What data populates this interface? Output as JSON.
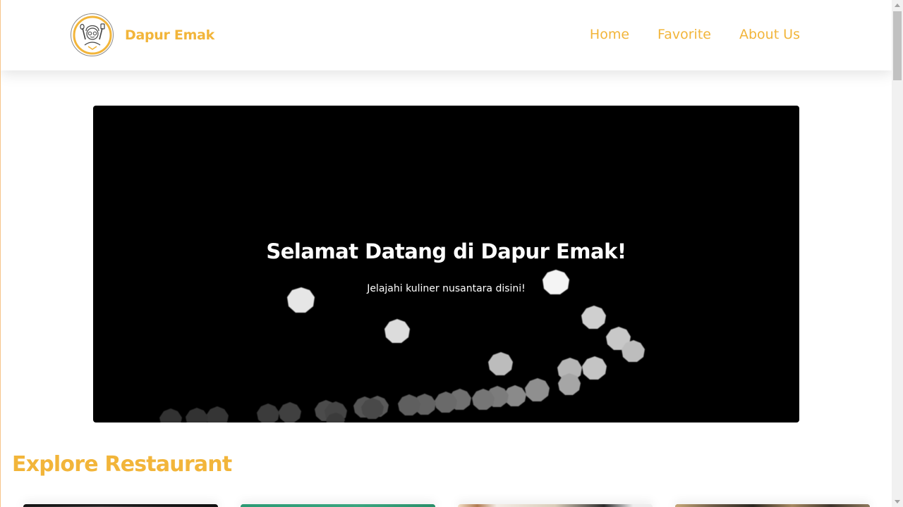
{
  "header": {
    "brand_name": "Dapur Emak",
    "logo_icon": "grandma-chef-logo",
    "nav": [
      {
        "label": "Home"
      },
      {
        "label": "Favorite"
      },
      {
        "label": "About Us"
      }
    ]
  },
  "hero": {
    "title": "Selamat Datang di Dapur Emak!",
    "subtitle": "Jelajahi kuliner nusantara disini!",
    "image": "bokeh-lights"
  },
  "explore": {
    "title": "Explore Restaurant",
    "cards": [
      {
        "image": "restaurant-photo-1"
      },
      {
        "image": "restaurant-photo-2"
      },
      {
        "image": "restaurant-photo-3"
      },
      {
        "image": "restaurant-photo-4"
      }
    ]
  },
  "colors": {
    "accent": "#f2b53a",
    "hero_bg": "#000000",
    "header_bg": "#ffffff"
  }
}
